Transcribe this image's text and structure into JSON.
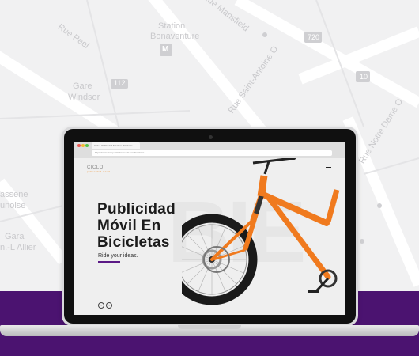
{
  "map": {
    "labels": [
      "Rue Peel",
      "Station",
      "Bonaventure",
      "Gare",
      "Windsor",
      "Rue Saint-Antoine O",
      "Rue Mansfield",
      "Rue Notre Dame O",
      "assene",
      "unoise",
      "Gara",
      "n.-L Allier",
      "112",
      "720",
      "10",
      "M"
    ]
  },
  "browser": {
    "tab_title": "Ciclo - Publicidad Móvil en Bicicletas",
    "url": "https://www.ciclopublicidadmovil.com/bicicletas"
  },
  "site": {
    "logo": "CICLO",
    "logo_tagline": "publicidad móvil",
    "watermark": "BIE",
    "headline": [
      "Publicidad",
      "Móvil En",
      "Bicicletas"
    ],
    "subtitle": "Ride your ideas.",
    "social": [
      "f",
      "t"
    ]
  },
  "colors": {
    "purple": "#4b1370",
    "accent": "#5b1a86",
    "bike_orange": "#f07a1e"
  }
}
